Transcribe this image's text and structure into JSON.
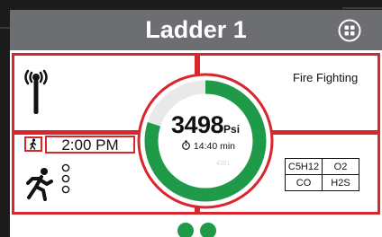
{
  "header": {
    "title": "Ladder 1",
    "apps_icon": "grid-apps-icon"
  },
  "panels": {
    "top_left": {
      "icon": "radio-signal-icon"
    },
    "top_right": {
      "label": "Fire Fighting"
    }
  },
  "gauge": {
    "pressure_value": "3498",
    "pressure_unit": "Psi",
    "remaining_time": "14:40 min",
    "sub_value": "4351",
    "fill_fraction": 0.8,
    "fill_color": "#1f9a48",
    "track_color": "#e9e9e9"
  },
  "status": {
    "mode_icon": "walking-person-icon",
    "clock": "2:00 PM",
    "motion_icon": "running-person-icon",
    "indicator_icon": "three-circles-icon"
  },
  "gas_sensors": [
    [
      "C5H12",
      "O2"
    ],
    [
      "CO",
      "H2S"
    ]
  ],
  "footer": {
    "indicator_count": 2,
    "indicator_color": "#1f9a48"
  },
  "colors": {
    "frame": "#d9262c",
    "header": "#6d6e71",
    "accent": "#1f9a48"
  }
}
